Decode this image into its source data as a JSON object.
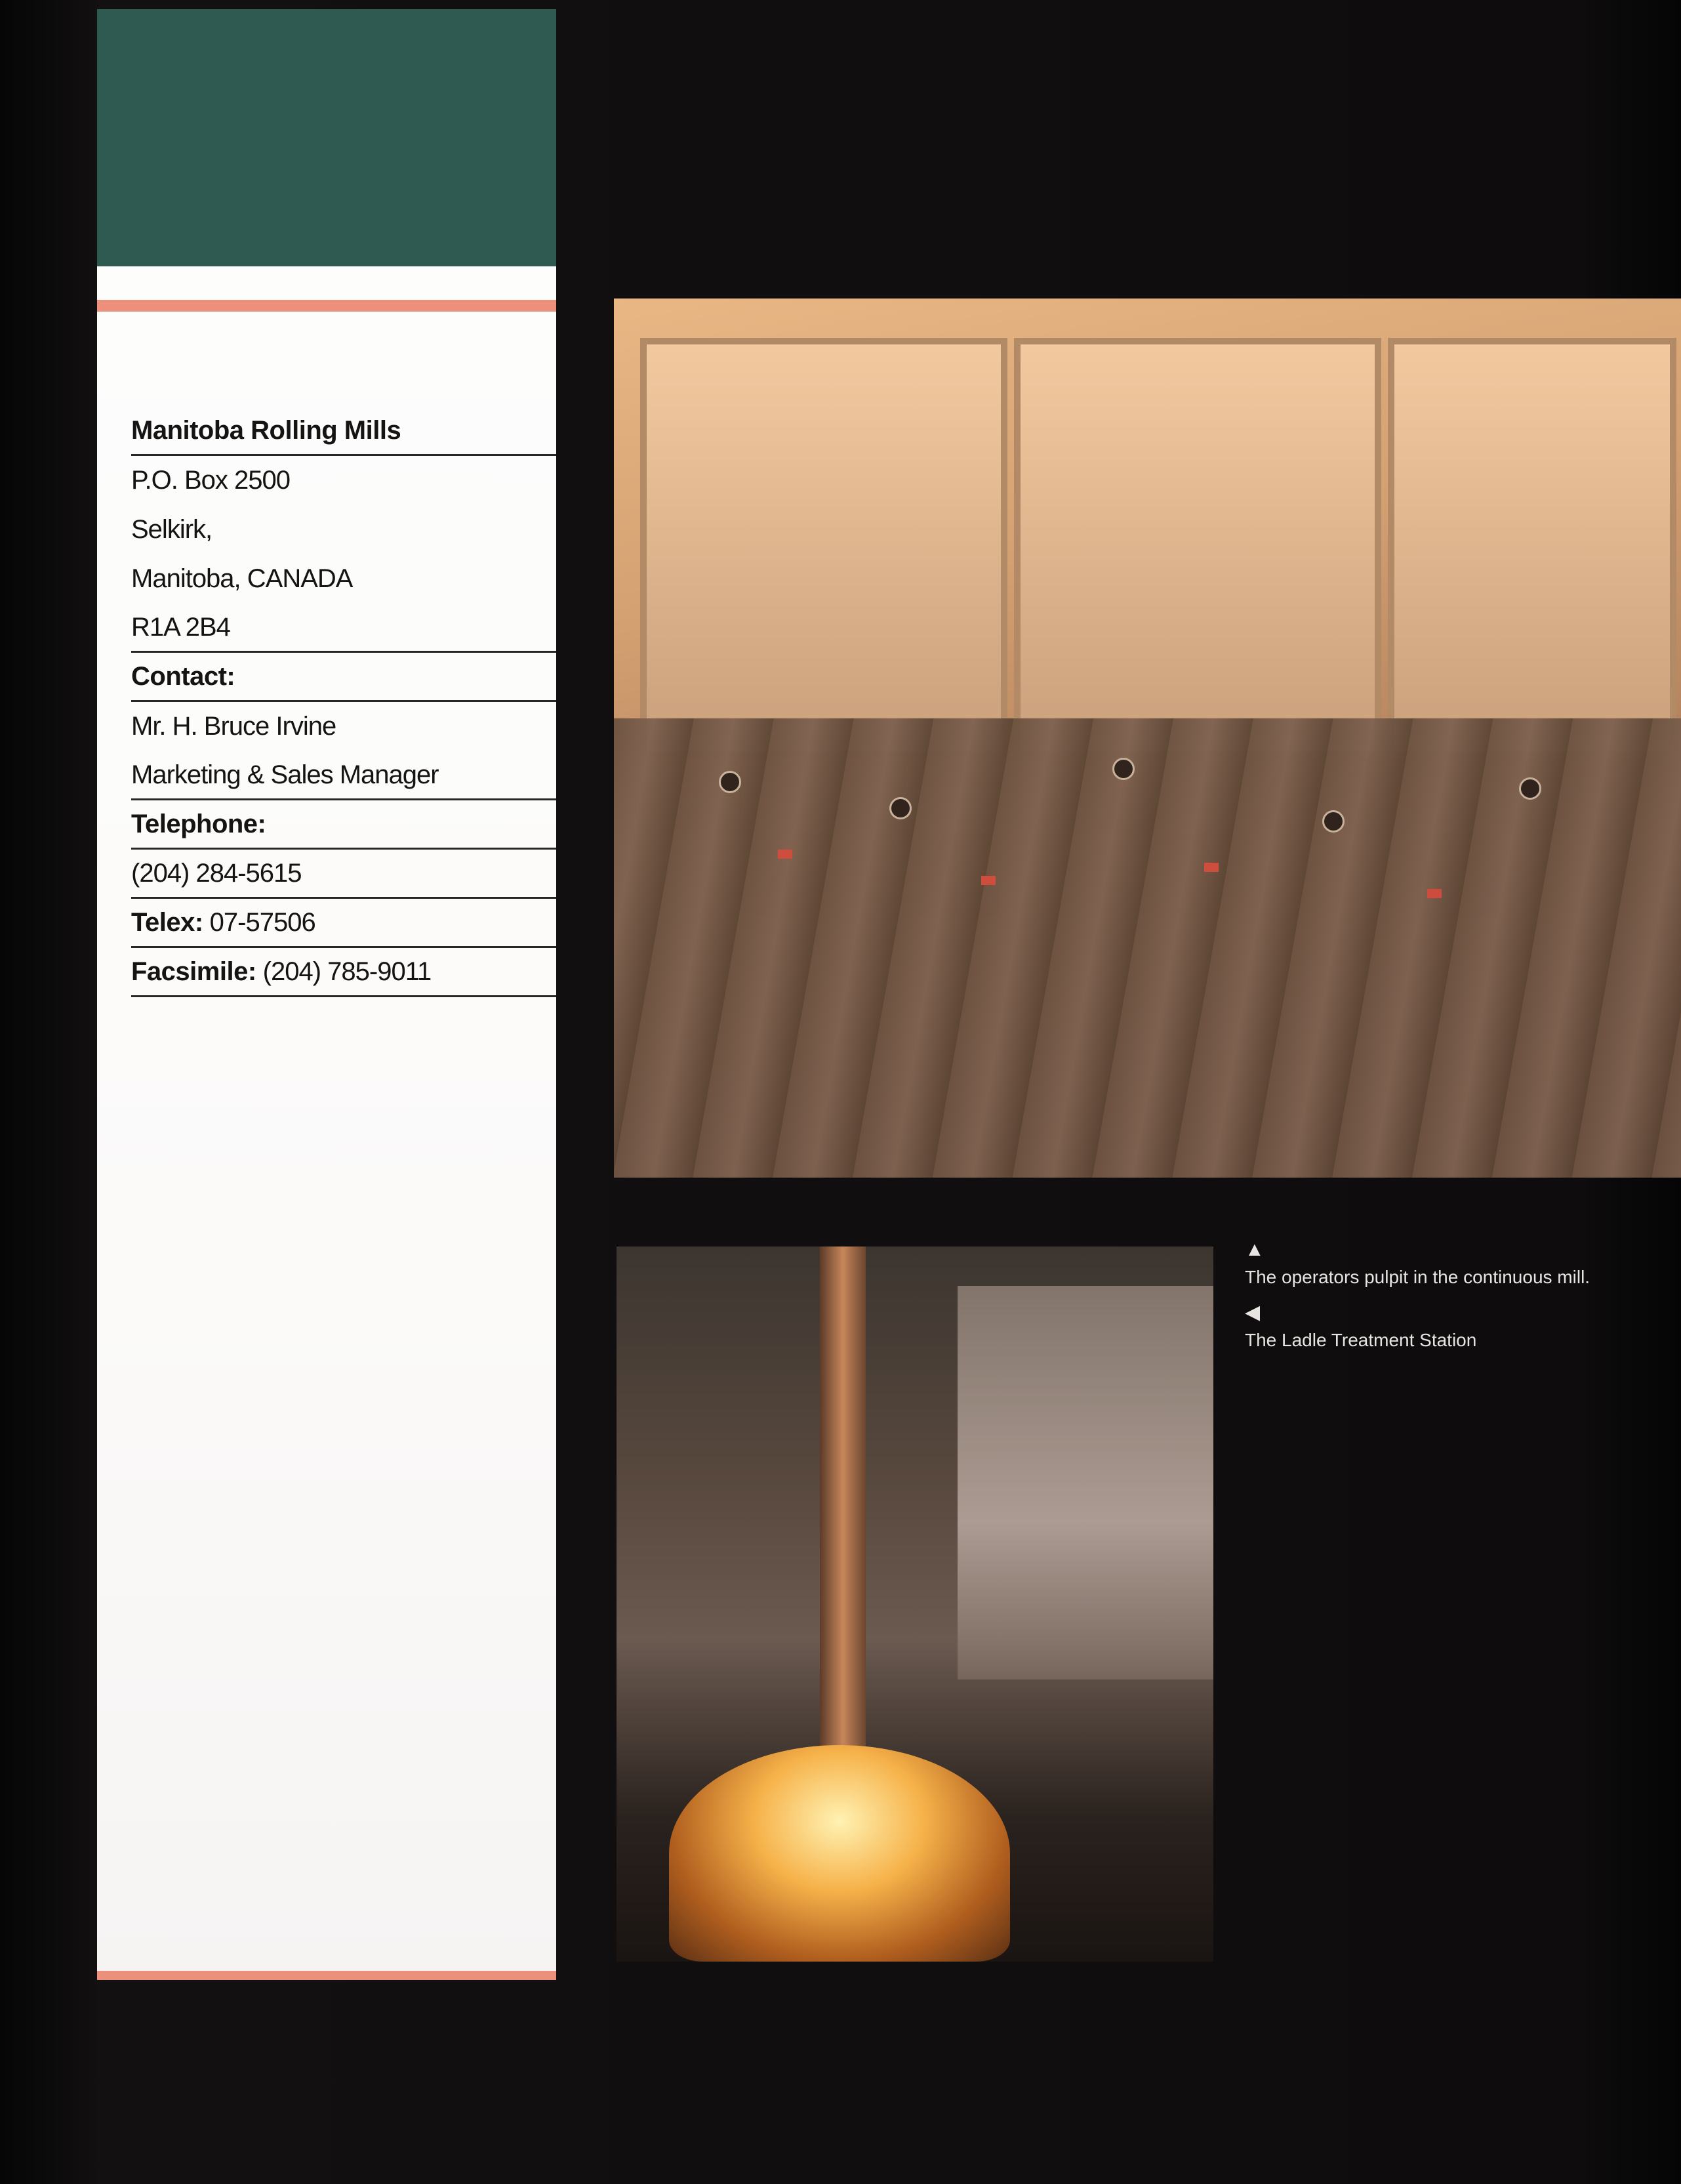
{
  "contact": {
    "company": "Manitoba Rolling Mills",
    "address": [
      "P.O. Box 2500",
      "Selkirk,",
      "Manitoba, CANADA",
      "R1A 2B4"
    ],
    "contact_heading": "Contact:",
    "contact_name": "Mr. H. Bruce Irvine",
    "contact_title": "Marketing & Sales Manager",
    "telephone_heading": "Telephone:",
    "telephone": "(204) 284-5615",
    "telex_label": "Telex:",
    "telex": "07-57506",
    "facsimile_label": "Facsimile:",
    "facsimile": "(204) 785-9011"
  },
  "captions": {
    "pulpit_marker": "▲",
    "pulpit": "The operators pulpit in the continuous mill.",
    "ladle_marker": "◀",
    "ladle": "The Ladle Treatment Station"
  },
  "colors": {
    "green_band": "#2e5a52",
    "salmon_rule": "#ec8f7b",
    "background": "#0b0a0a"
  }
}
